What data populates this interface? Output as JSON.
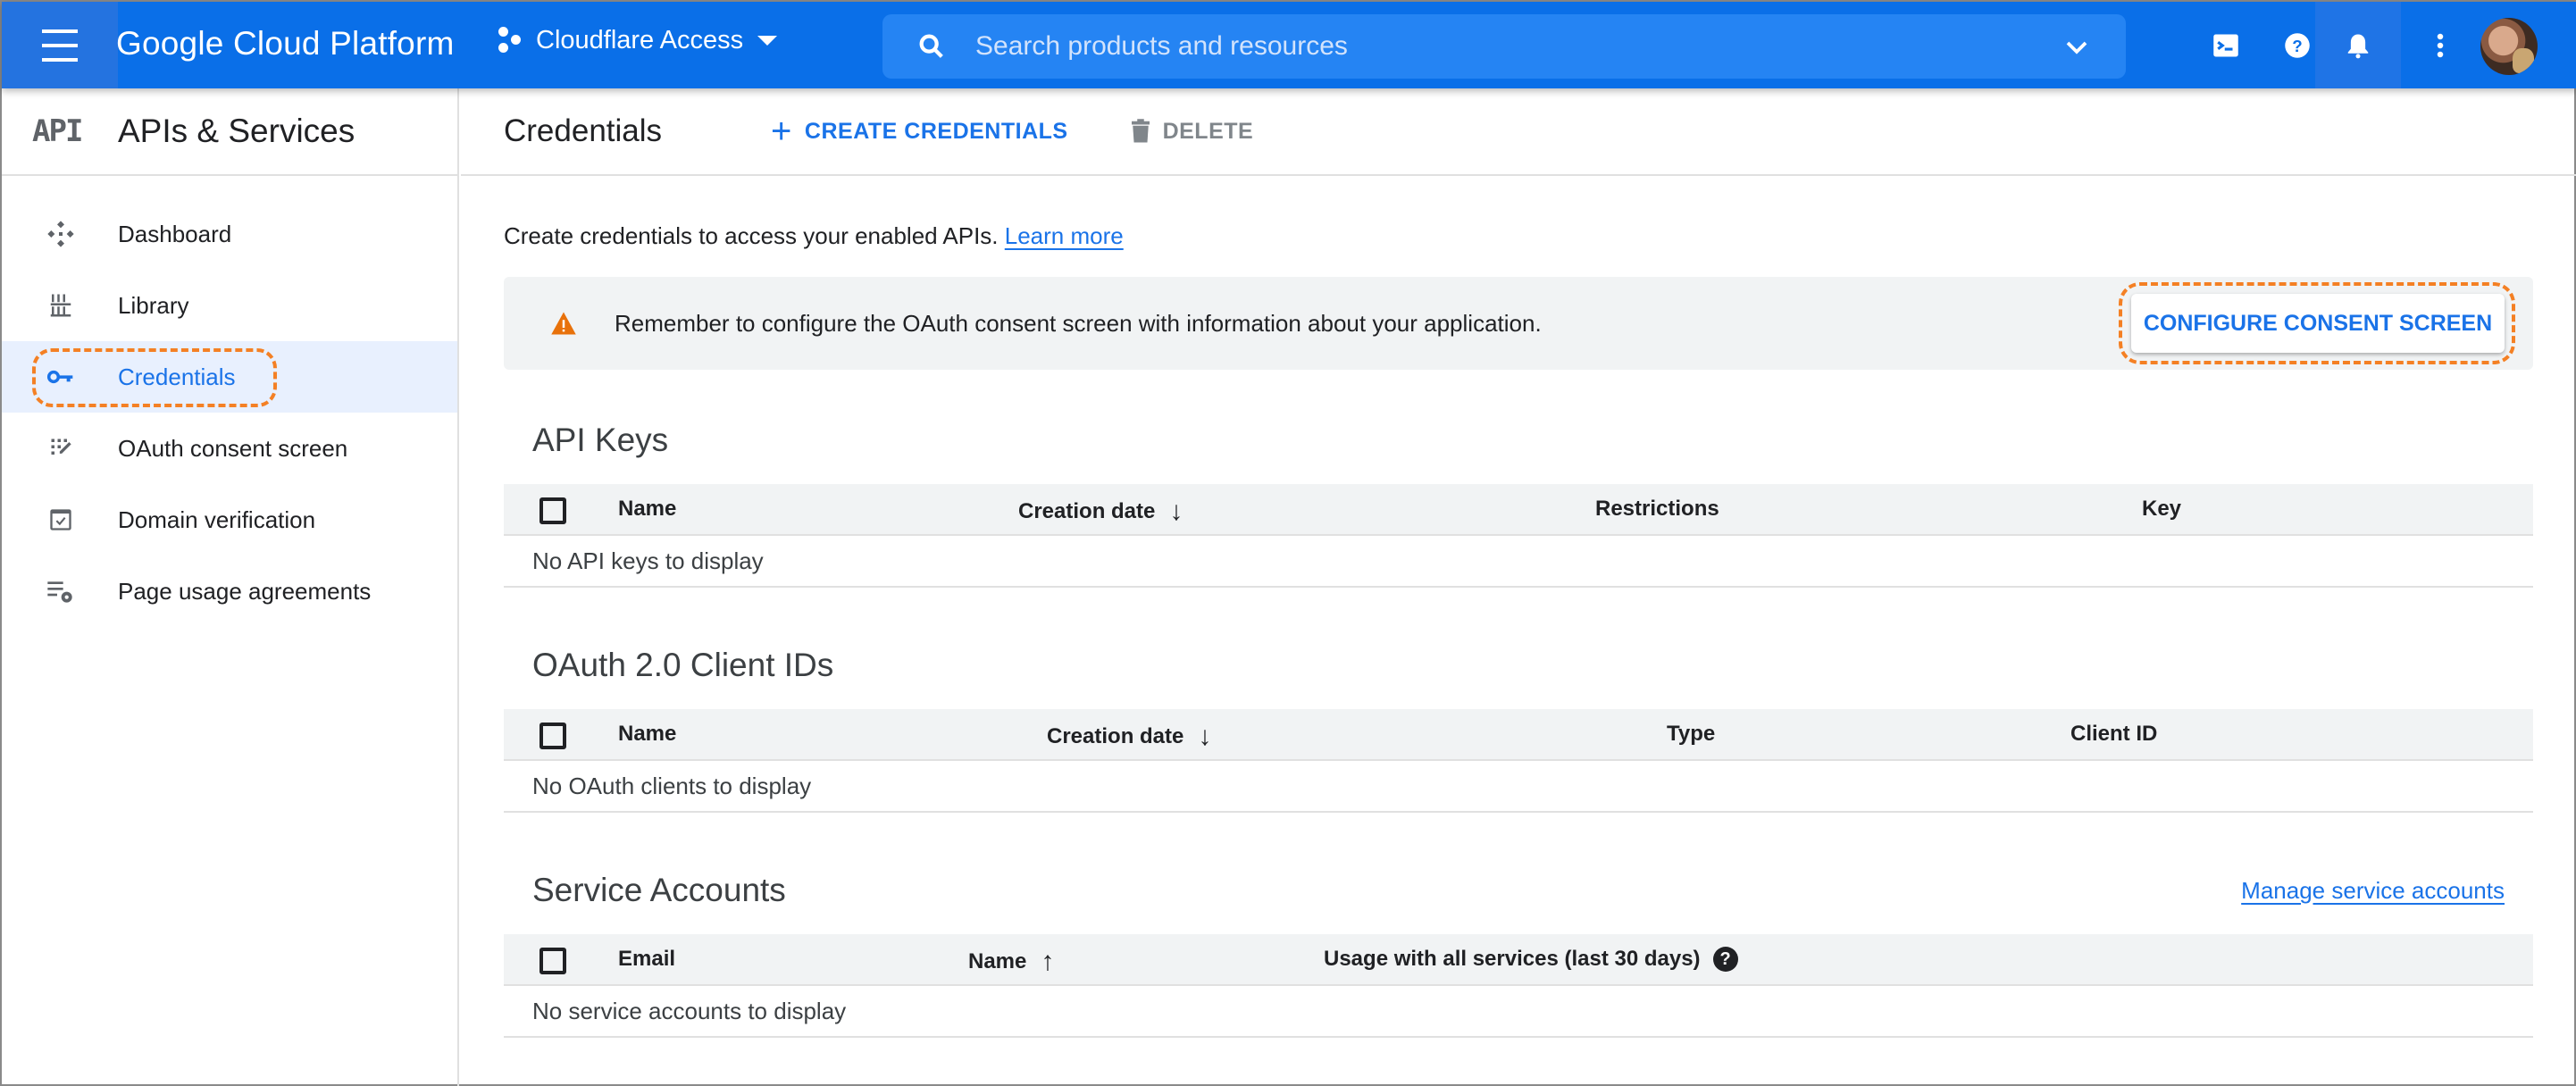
{
  "topbar": {
    "brand": "Google Cloud Platform",
    "project": "Cloudflare Access",
    "search_placeholder": "Search products and resources",
    "icons": [
      "menu-icon",
      "project-icon",
      "search-icon",
      "chevron-down-icon",
      "cloud-shell-icon",
      "help-icon",
      "notifications-icon",
      "more-vert-icon",
      "avatar"
    ]
  },
  "sidebar": {
    "logo": "API",
    "title": "APIs & Services",
    "items": [
      {
        "label": "Dashboard",
        "icon": "dashboard-icon",
        "active": false
      },
      {
        "label": "Library",
        "icon": "library-icon",
        "active": false
      },
      {
        "label": "Credentials",
        "icon": "key-icon",
        "active": true
      },
      {
        "label": "OAuth consent screen",
        "icon": "oauth-consent-icon",
        "active": false
      },
      {
        "label": "Domain verification",
        "icon": "domain-verification-icon",
        "active": false
      },
      {
        "label": "Page usage agreements",
        "icon": "page-usage-icon",
        "active": false
      }
    ]
  },
  "main": {
    "title": "Credentials",
    "create_label": "CREATE CREDENTIALS",
    "delete_label": "DELETE",
    "intro_text": "Create credentials to access your enabled APIs.",
    "learn_more": "Learn more",
    "alert": {
      "text": "Remember to configure the OAuth consent screen with information about your application.",
      "button": "CONFIGURE CONSENT SCREEN"
    },
    "api_keys": {
      "title": "API Keys",
      "columns": [
        "Name",
        "Creation date",
        "Restrictions",
        "Key"
      ],
      "sort_arrow": "↓",
      "empty": "No API keys to display"
    },
    "oauth_clients": {
      "title": "OAuth 2.0 Client IDs",
      "columns": [
        "Name",
        "Creation date",
        "Type",
        "Client ID"
      ],
      "sort_arrow": "↓",
      "empty": "No OAuth clients to display"
    },
    "service_accounts": {
      "title": "Service Accounts",
      "manage_link": "Manage service accounts",
      "columns": [
        "Email",
        "Name",
        "Usage with all services (last 30 days)"
      ],
      "sort_arrow": "↑",
      "help": "?",
      "empty": "No service accounts to display"
    }
  },
  "colors": {
    "topbar": "#0a6fe8",
    "accent": "#1a73e8",
    "highlight_dash": "#f48024",
    "warning": "#e8710a"
  }
}
